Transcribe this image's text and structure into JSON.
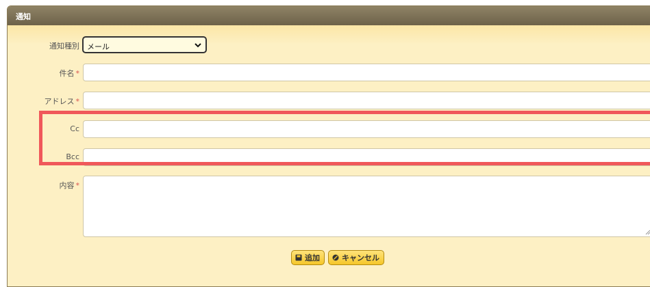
{
  "dialog": {
    "title": "通知"
  },
  "form": {
    "type": {
      "label": "通知種別",
      "value": "メール"
    },
    "subject": {
      "label": "件名",
      "required_mark": "*",
      "value": ""
    },
    "address": {
      "label": "アドレス",
      "required_mark": "*",
      "value": ""
    },
    "cc": {
      "label": "Cc",
      "value": ""
    },
    "bcc": {
      "label": "Bcc",
      "value": ""
    },
    "content": {
      "label": "内容",
      "required_mark": "*",
      "value": ""
    }
  },
  "buttons": {
    "add": "追加",
    "cancel": "キャンセル"
  },
  "colors": {
    "background": "#fdf0c4",
    "titlebar": "#7a6f54",
    "highlight": "#f0585a",
    "button": "#f5c629",
    "required": "#d9534f"
  }
}
